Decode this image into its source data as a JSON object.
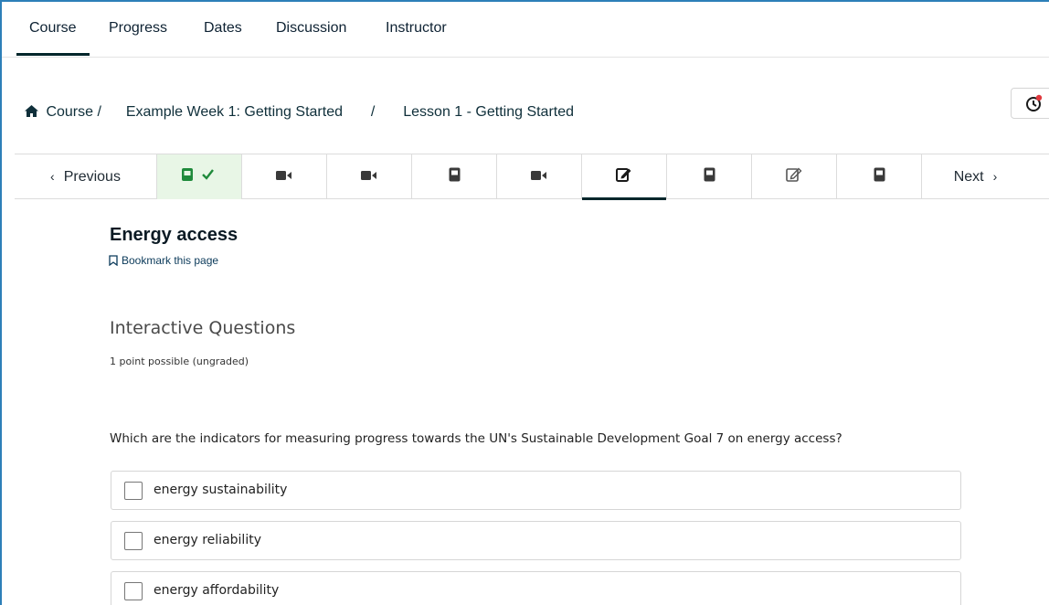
{
  "tabs": [
    {
      "label": "Course",
      "active": true
    },
    {
      "label": "Progress"
    },
    {
      "label": "Dates"
    },
    {
      "label": "Discussion"
    },
    {
      "label": "Instructor"
    }
  ],
  "breadcrumb": {
    "home_label": "Course /",
    "items": [
      "Example Week 1: Getting Started",
      "Lesson 1 - Getting Started"
    ],
    "separator": "/"
  },
  "notification_button": {
    "icon": "clock-notification-icon",
    "badge_color": "#e0393e"
  },
  "sequence_nav": {
    "previous_label": "Previous",
    "next_label": "Next",
    "units": [
      {
        "icon": "book-check-icon",
        "completed": true
      },
      {
        "icon": "video-icon"
      },
      {
        "icon": "video-icon"
      },
      {
        "icon": "book-icon"
      },
      {
        "icon": "video-icon"
      },
      {
        "icon": "edit-icon",
        "active": true
      },
      {
        "icon": "book-icon"
      },
      {
        "icon": "edit-icon"
      },
      {
        "icon": "book-icon"
      }
    ]
  },
  "unit": {
    "title": "Energy access",
    "bookmark_label": "Bookmark this page"
  },
  "problem": {
    "title": "Interactive Questions",
    "points": "1 point possible (ungraded)",
    "question": "Which are the indicators for measuring progress towards the UN's Sustainable Development Goal 7 on energy access?",
    "choices": [
      "energy sustainability",
      "energy reliability",
      "energy affordability"
    ]
  },
  "colors": {
    "accent": "#00262b",
    "completed_bg": "#e8f6e6",
    "completed_icon": "#1f8a3b",
    "frame_border": "#2d7fb8"
  }
}
